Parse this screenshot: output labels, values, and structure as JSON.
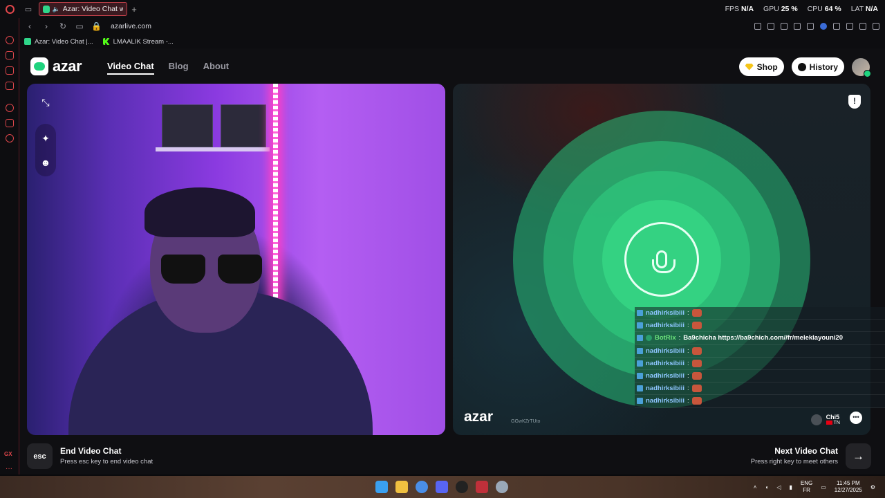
{
  "browser": {
    "tab_title": "Azar: Video Chat with",
    "new_tab": "+",
    "stats": {
      "fps_label": "FPS",
      "fps_value": "N/A",
      "gpu_label": "GPU",
      "gpu_value": "25 %",
      "cpu_label": "CPU",
      "cpu_value": "64 %",
      "lat_label": "LAT",
      "lat_value": "N/A"
    },
    "url": "azarlive.com",
    "bookmarks": [
      "Azar: Video Chat |...",
      "LMAALIK Stream -..."
    ],
    "sidebar_gx": "GX",
    "sidebar_more": "···"
  },
  "azar": {
    "logo_text": "azar",
    "nav": [
      "Video Chat",
      "Blog",
      "About"
    ],
    "shop_label": "Shop",
    "history_label": "History",
    "report_icon": "!",
    "watermark": "azar",
    "session_code": "GGwKZrTUto",
    "peer": {
      "name": "Chi5",
      "country": "TN"
    },
    "chat": [
      {
        "user": "nadhirksibiii",
        "sep": ":",
        "msg": ""
      },
      {
        "user": "nadhirksibiii",
        "sep": ":",
        "msg": ""
      },
      {
        "user": "BotRix",
        "sep": ":",
        "msg": "Ba9chicha https://ba9chich.com//fr/meleklayouni20",
        "bot": true
      },
      {
        "user": "nadhirksibiii",
        "sep": ":",
        "msg": ""
      },
      {
        "user": "nadhirksibiii",
        "sep": ":",
        "msg": ""
      },
      {
        "user": "nadhirksibiii",
        "sep": ":",
        "msg": ""
      },
      {
        "user": "nadhirksibiii",
        "sep": ":",
        "msg": ""
      },
      {
        "user": "nadhirksibiii",
        "sep": ":",
        "msg": ""
      }
    ],
    "footer": {
      "esc_key": "esc",
      "end_title": "End Video Chat",
      "end_sub": "Press esc key to end video chat",
      "next_title": "Next Video Chat",
      "next_sub": "Press right key to meet others",
      "next_arrow": "→"
    }
  },
  "taskbar": {
    "lang_top": "ENG",
    "lang_bottom": "FR",
    "time": "11:45 PM",
    "date": "12/27/2025"
  },
  "colors": {
    "azar_green": "#1fd37e",
    "gx_red": "#e0464b"
  }
}
